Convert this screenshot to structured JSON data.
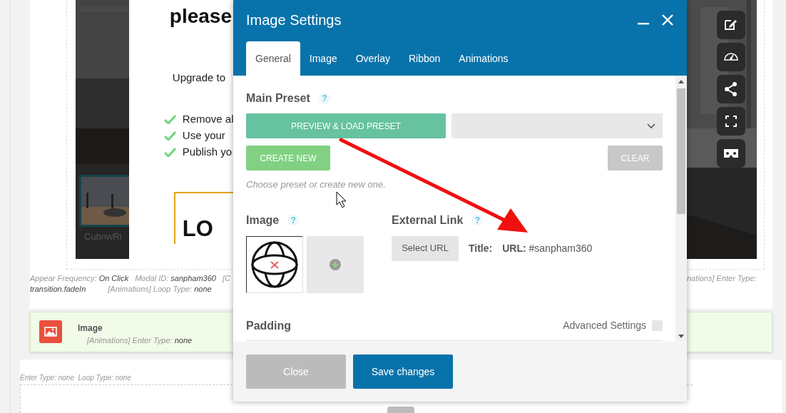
{
  "editor": {
    "popup_preview": {
      "heading": "please",
      "subheading": "Upgrade to",
      "features": [
        "Remove al",
        "Use your",
        "Publish yo"
      ],
      "logo_text": "LO",
      "thumbnail_caption": "CubnwRi"
    },
    "meta_left": [
      {
        "label": "Appear Frequency:",
        "value": "On Click"
      },
      {
        "label": "Modal ID:",
        "value": "sanpham360"
      },
      {
        "label": "[C"
      }
    ],
    "meta_right": [
      {
        "label": "nations] Enter Type:"
      }
    ],
    "meta_second": [
      {
        "value": "transition.fadeIn"
      },
      {
        "label": "[Animations] Loop Type:",
        "value": "none"
      }
    ],
    "element": {
      "title": "Image",
      "meta": [
        {
          "label": "[Animations] Enter Type:",
          "value": "none"
        }
      ]
    },
    "bottom_meta": [
      {
        "label": "Enter Type:",
        "value": "none"
      },
      {
        "label": "Loop Type:",
        "value": "none"
      }
    ]
  },
  "modal": {
    "title": "Image Settings",
    "tabs": [
      {
        "label": "General",
        "selected": true
      },
      {
        "label": "Image",
        "selected": false
      },
      {
        "label": "Overlay",
        "selected": false
      },
      {
        "label": "Ribbon",
        "selected": false
      },
      {
        "label": "Animations",
        "selected": false
      }
    ],
    "main_preset": {
      "label": "Main Preset",
      "help": "?",
      "preview_button": "PREVIEW & LOAD PRESET",
      "create_button": "CREATE NEW",
      "clear_button": "CLEAR",
      "hint": "Choose preset or create new one."
    },
    "image_section": {
      "label": "Image",
      "help": "?"
    },
    "external_link": {
      "label": "External Link",
      "help": "?",
      "select_button": "Select URL",
      "title_label": "Title:",
      "url_label": "URL:",
      "url_value": "#sanpham360"
    },
    "padding": {
      "label": "Padding",
      "advanced_label": "Advanced Settings",
      "advanced_checked": false
    },
    "buttons": {
      "close": "Close",
      "save": "Save changes"
    }
  }
}
